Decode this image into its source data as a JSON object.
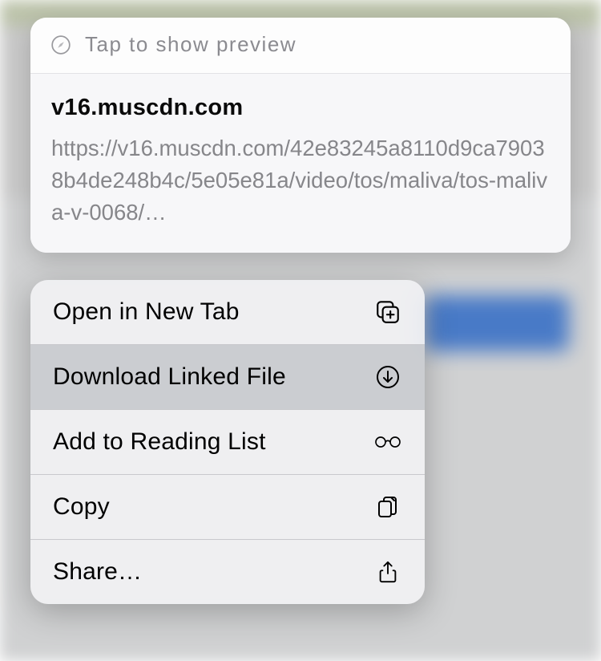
{
  "preview": {
    "tap_label": "Tap to show preview",
    "domain": "v16.muscdn.com",
    "url": "https://v16.muscdn.com/42e83245a8110d9ca79038b4de248b4c/5e05e81a/video/tos/maliva/tos-maliva-v-0068/…"
  },
  "menu": {
    "items": [
      {
        "label": "Open in New Tab",
        "icon": "plus-tab-icon",
        "highlight": false
      },
      {
        "label": "Download Linked File",
        "icon": "download-icon",
        "highlight": true
      },
      {
        "label": "Add to Reading List",
        "icon": "glasses-icon",
        "highlight": false
      },
      {
        "label": "Copy",
        "icon": "copy-icon",
        "highlight": false
      },
      {
        "label": "Share…",
        "icon": "share-icon",
        "highlight": false
      }
    ]
  }
}
